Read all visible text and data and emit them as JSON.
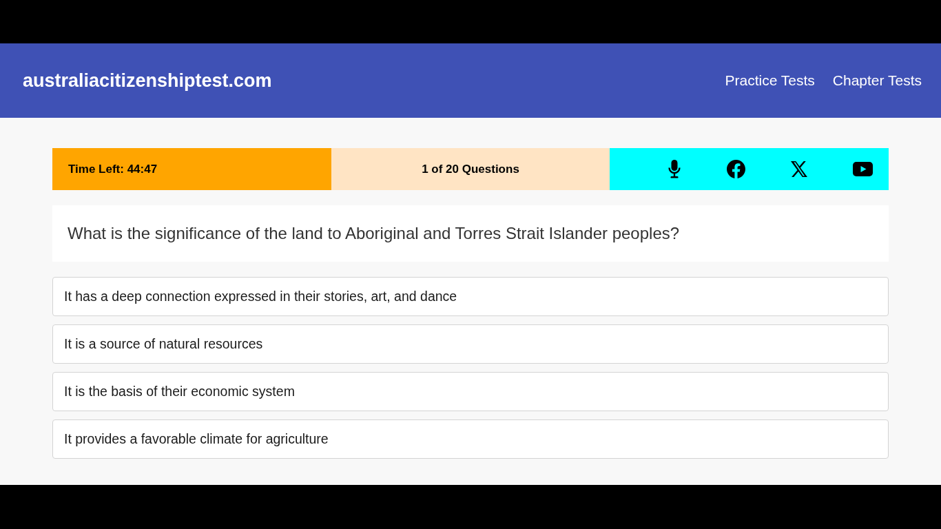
{
  "header": {
    "logo": "australiacitizenshiptest.com",
    "nav": [
      {
        "label": "Practice Tests"
      },
      {
        "label": "Chapter Tests"
      }
    ]
  },
  "status_bar": {
    "timer": "Time Left: 44:47",
    "progress": "1 of 20 Questions",
    "icons": [
      {
        "kind": "microphone"
      },
      {
        "kind": "facebook"
      },
      {
        "kind": "x"
      },
      {
        "kind": "youtube"
      }
    ]
  },
  "question": "What is the significance of the land to Aboriginal and Torres Strait Islander peoples?",
  "options": [
    {
      "label": "It has a deep connection expressed in their stories, art, and dance",
      "selected": false
    },
    {
      "label": "It is a source of natural resources",
      "selected": false
    },
    {
      "label": "It is the basis of their economic system",
      "selected": false
    },
    {
      "label": "It provides a favorable climate for agriculture",
      "selected": false
    }
  ]
}
